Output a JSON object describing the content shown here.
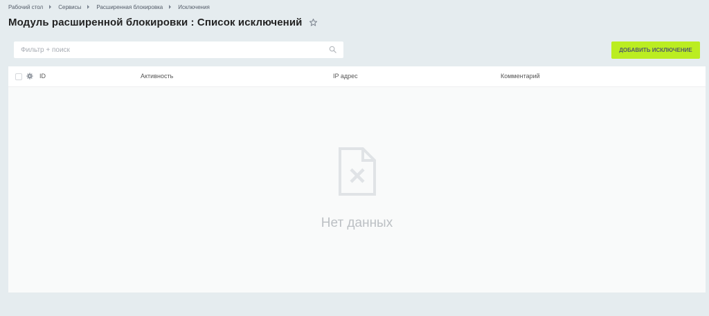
{
  "breadcrumb": {
    "items": [
      {
        "label": "Рабочий стол"
      },
      {
        "label": "Сервисы"
      },
      {
        "label": "Расширенная блокировка"
      },
      {
        "label": "Исключения"
      }
    ]
  },
  "page": {
    "title": "Модуль расширенной блокировки : Список исключений",
    "favorite_icon": "star-icon"
  },
  "toolbar": {
    "search_placeholder": "Фильтр + поиск",
    "search_value": "",
    "search_icon": "search-icon",
    "add_button_label": "ДОБАВИТЬ ИСКЛЮЧЕНИЕ",
    "accent_color": "#bbed21"
  },
  "grid": {
    "columns": [
      {
        "label": "ID"
      },
      {
        "label": "Активность"
      },
      {
        "label": "IP адрес"
      },
      {
        "label": "Комментарий"
      }
    ],
    "settings_icon": "gear-icon",
    "rows": [],
    "empty_text": "Нет данных",
    "empty_icon": "no-data-file-icon"
  }
}
